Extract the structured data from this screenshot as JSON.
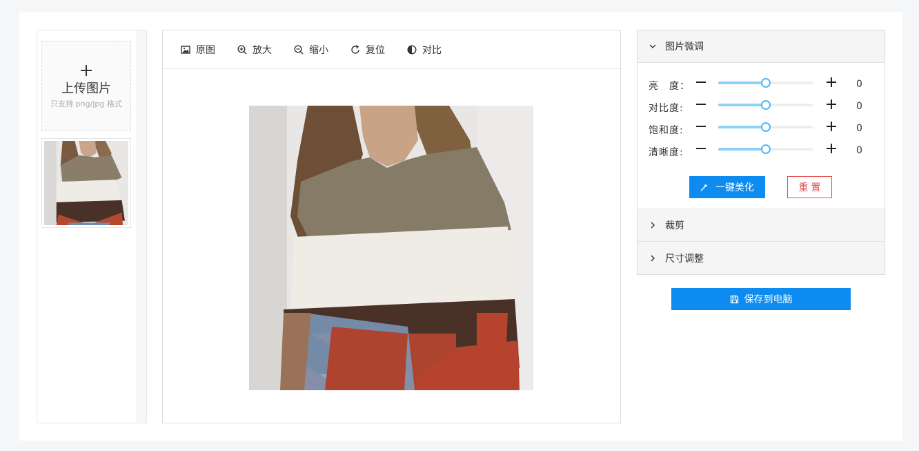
{
  "upload": {
    "title": "上传图片",
    "hint": "只支持 png/jpg 格式"
  },
  "toolbar": {
    "items": [
      {
        "label": "原图",
        "icon": "image-icon"
      },
      {
        "label": "放大",
        "icon": "zoom-in-icon"
      },
      {
        "label": "缩小",
        "icon": "zoom-out-icon"
      },
      {
        "label": "复位",
        "icon": "reset-icon"
      },
      {
        "label": "对比",
        "icon": "contrast-icon"
      }
    ]
  },
  "adjust": {
    "title": "图片微调",
    "sliders": [
      {
        "label": "亮　度：",
        "value": "0",
        "level": 0.5
      },
      {
        "label": "对比度:",
        "value": "0",
        "level": 0.5
      },
      {
        "label": "饱和度:",
        "value": "0",
        "level": 0.5
      },
      {
        "label": "清晰度:",
        "value": "0",
        "level": 0.5
      }
    ],
    "beautify_label": "一键美化",
    "reset_label": "重置"
  },
  "crop": {
    "title": "裁剪"
  },
  "resize": {
    "title": "尺寸调整"
  },
  "save_label": "保存到电脑",
  "colors": {
    "primary": "#0e8bf0",
    "danger": "#e54d4d",
    "slider_fill": "#8dd0f8"
  }
}
